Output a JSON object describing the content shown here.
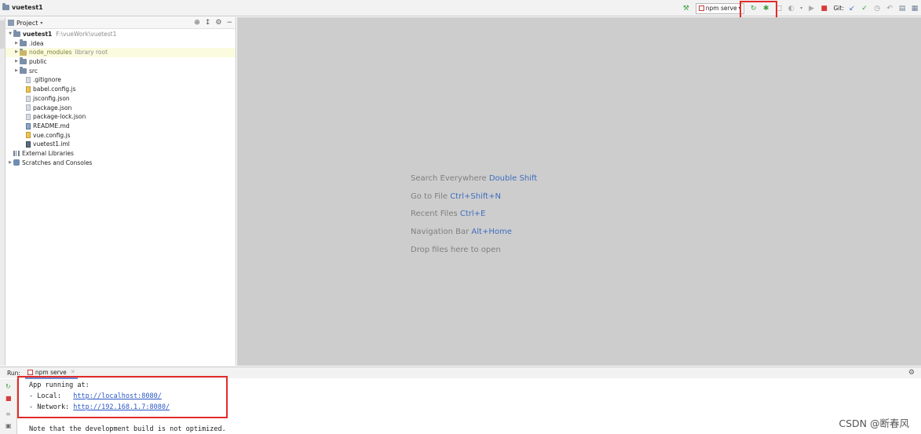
{
  "navbar": {
    "project_name": "vuetest1",
    "run_config": "npm serve",
    "git_label": "Git:"
  },
  "project_panel": {
    "title": "Project",
    "tree": {
      "root_name": "vuetest1",
      "root_path": "F:\\vueWork\\vuetest1",
      "idea": ".idea",
      "node_modules": "node_modules",
      "node_modules_note": "library root",
      "public": "public",
      "src": "src",
      "gitignore": ".gitignore",
      "babel": "babel.config.js",
      "jsconfig": "jsconfig.json",
      "package": "package.json",
      "package_lock": "package-lock.json",
      "readme": "README.md",
      "vue_config": "vue.config.js",
      "iml": "vuetest1.iml",
      "external_libraries": "External Libraries",
      "scratches": "Scratches and Consoles"
    }
  },
  "editor": {
    "hints": [
      {
        "text": "Search Everywhere",
        "key": "Double Shift"
      },
      {
        "text": "Go to File",
        "key": "Ctrl+Shift+N"
      },
      {
        "text": "Recent Files",
        "key": "Ctrl+E"
      },
      {
        "text": "Navigation Bar",
        "key": "Alt+Home"
      },
      {
        "text": "Drop files here to open",
        "key": ""
      }
    ]
  },
  "run": {
    "label": "Run:",
    "tab_name": "npm serve",
    "console": {
      "line1": "App running at:",
      "local_label": "- Local:   ",
      "local_url": "http://localhost:8080/",
      "network_label": "- Network: ",
      "network_url": "http://192.168.1.7:8080/",
      "note": "Note that the development build is not optimized."
    }
  },
  "watermark": "CSDN @断春风",
  "colors": {
    "highlight_frame": "#e32b2b",
    "link": "#2a57c6",
    "hint_key": "#3f6ebf",
    "editor_bg": "#cdcdcd"
  }
}
